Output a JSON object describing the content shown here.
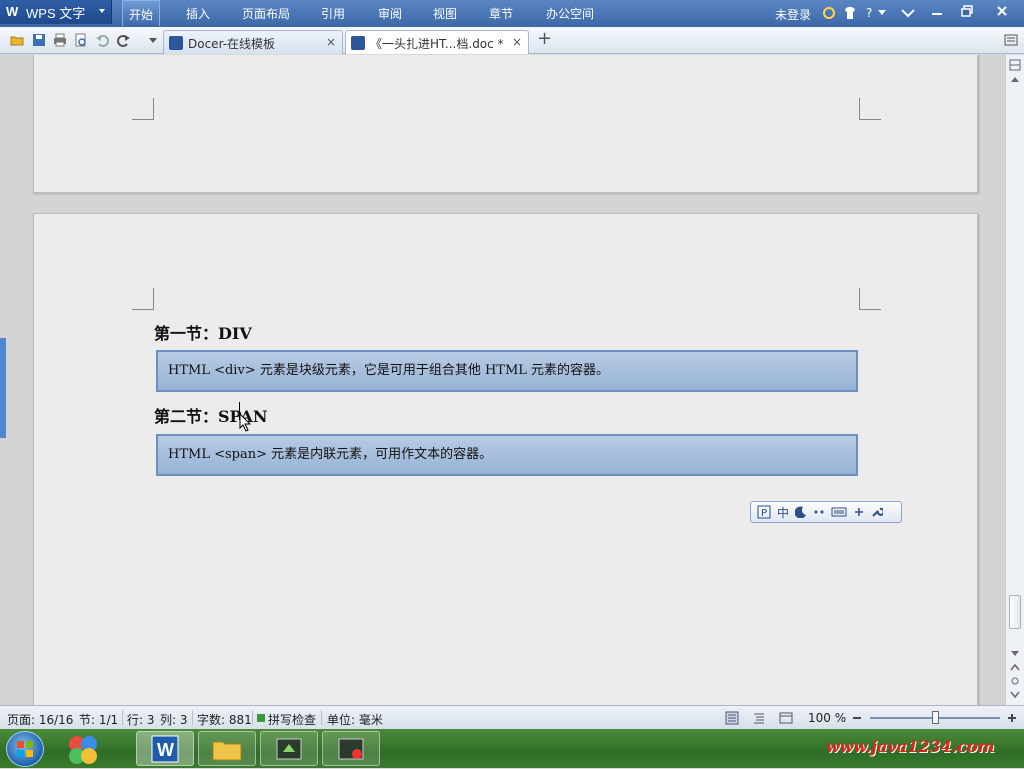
{
  "menubar": {
    "brand_logo": "W",
    "brand": "WPS 文字",
    "tabs": [
      "开始",
      "插入",
      "页面布局",
      "引用",
      "审阅",
      "视图",
      "章节",
      "办公空间"
    ],
    "login": "未登录",
    "help": "?"
  },
  "tabs": {
    "tab1_label": "Docer-在线模板",
    "tab2_label": "《一头扎进HT...档.doc *",
    "close_glyph": "×",
    "add_glyph": "+"
  },
  "document": {
    "section1_heading": "第一节：DIV",
    "section1_text": "HTML <div> 元素是块级元素，它是可用于组合其他 HTML 元素的容器。",
    "section2_heading": "第二节：SPAN",
    "section2_text": "HTML <span> 元素是内联元素，可用作文本的容器。"
  },
  "ime_toolbar": {
    "mode": "中"
  },
  "statusbar": {
    "page": "页面: 16/16",
    "section": "节: 1/1",
    "row": "行: 3",
    "col": "列: 3",
    "words": "字数: 881",
    "spellcheck": "拼写检查",
    "unit": "单位: 毫米",
    "zoom": "100 %"
  },
  "taskbar": {
    "watermark": "www.java1234.com"
  },
  "colors": {
    "menubar": "#3c68a8",
    "box_fill": "#a8c0de",
    "box_border": "#6d8fbd",
    "watermark": "#d8261c"
  }
}
